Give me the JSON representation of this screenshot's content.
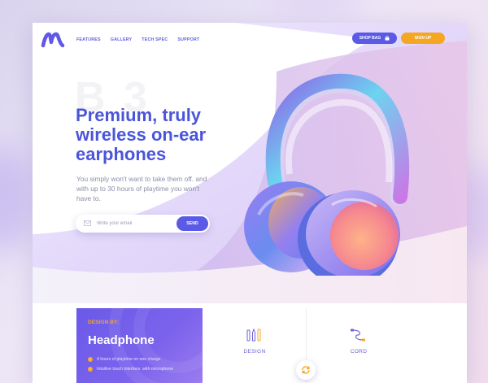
{
  "nav": {
    "links": [
      "FEATURES",
      "GALLERY",
      "TECH SPEC",
      "SUPPORT"
    ],
    "shop_bag_label": "SHOP BAG",
    "signup_label": "SIGN UP"
  },
  "hero": {
    "ghost_text": "B 3",
    "headline_lines": [
      "Premium, truly",
      "wireless on-ear",
      "earphones"
    ],
    "subtext": "You simply won't want to take them off. and with up to 30 hours of playtime you won't have to.",
    "email_placeholder": "Write your email",
    "send_label": "SEND"
  },
  "card": {
    "design_by": "DESIGN BY:",
    "title": "Headphone",
    "features": [
      "4 hours of playtime on one charge",
      "Intuitive touch interface, with microphone"
    ]
  },
  "grid": {
    "items": [
      {
        "label": "DESIGN",
        "icon": "design-tools-icon"
      },
      {
        "label": "CORD",
        "icon": "cord-icon"
      }
    ]
  },
  "colors": {
    "primary": "#5a5ae6",
    "accent": "#f5a623",
    "headline": "#4b55d8",
    "card_bg": "#6a5ae8"
  }
}
